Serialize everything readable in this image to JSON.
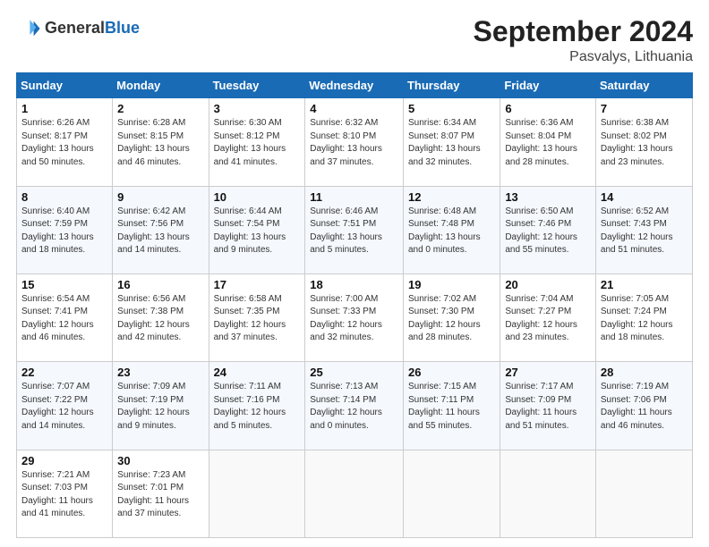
{
  "header": {
    "logo_general": "General",
    "logo_blue": "Blue",
    "month_title": "September 2024",
    "location": "Pasvalys, Lithuania"
  },
  "weekdays": [
    "Sunday",
    "Monday",
    "Tuesday",
    "Wednesday",
    "Thursday",
    "Friday",
    "Saturday"
  ],
  "weeks": [
    [
      {
        "day": "1",
        "info": "Sunrise: 6:26 AM\nSunset: 8:17 PM\nDaylight: 13 hours\nand 50 minutes."
      },
      {
        "day": "2",
        "info": "Sunrise: 6:28 AM\nSunset: 8:15 PM\nDaylight: 13 hours\nand 46 minutes."
      },
      {
        "day": "3",
        "info": "Sunrise: 6:30 AM\nSunset: 8:12 PM\nDaylight: 13 hours\nand 41 minutes."
      },
      {
        "day": "4",
        "info": "Sunrise: 6:32 AM\nSunset: 8:10 PM\nDaylight: 13 hours\nand 37 minutes."
      },
      {
        "day": "5",
        "info": "Sunrise: 6:34 AM\nSunset: 8:07 PM\nDaylight: 13 hours\nand 32 minutes."
      },
      {
        "day": "6",
        "info": "Sunrise: 6:36 AM\nSunset: 8:04 PM\nDaylight: 13 hours\nand 28 minutes."
      },
      {
        "day": "7",
        "info": "Sunrise: 6:38 AM\nSunset: 8:02 PM\nDaylight: 13 hours\nand 23 minutes."
      }
    ],
    [
      {
        "day": "8",
        "info": "Sunrise: 6:40 AM\nSunset: 7:59 PM\nDaylight: 13 hours\nand 18 minutes."
      },
      {
        "day": "9",
        "info": "Sunrise: 6:42 AM\nSunset: 7:56 PM\nDaylight: 13 hours\nand 14 minutes."
      },
      {
        "day": "10",
        "info": "Sunrise: 6:44 AM\nSunset: 7:54 PM\nDaylight: 13 hours\nand 9 minutes."
      },
      {
        "day": "11",
        "info": "Sunrise: 6:46 AM\nSunset: 7:51 PM\nDaylight: 13 hours\nand 5 minutes."
      },
      {
        "day": "12",
        "info": "Sunrise: 6:48 AM\nSunset: 7:48 PM\nDaylight: 13 hours\nand 0 minutes."
      },
      {
        "day": "13",
        "info": "Sunrise: 6:50 AM\nSunset: 7:46 PM\nDaylight: 12 hours\nand 55 minutes."
      },
      {
        "day": "14",
        "info": "Sunrise: 6:52 AM\nSunset: 7:43 PM\nDaylight: 12 hours\nand 51 minutes."
      }
    ],
    [
      {
        "day": "15",
        "info": "Sunrise: 6:54 AM\nSunset: 7:41 PM\nDaylight: 12 hours\nand 46 minutes."
      },
      {
        "day": "16",
        "info": "Sunrise: 6:56 AM\nSunset: 7:38 PM\nDaylight: 12 hours\nand 42 minutes."
      },
      {
        "day": "17",
        "info": "Sunrise: 6:58 AM\nSunset: 7:35 PM\nDaylight: 12 hours\nand 37 minutes."
      },
      {
        "day": "18",
        "info": "Sunrise: 7:00 AM\nSunset: 7:33 PM\nDaylight: 12 hours\nand 32 minutes."
      },
      {
        "day": "19",
        "info": "Sunrise: 7:02 AM\nSunset: 7:30 PM\nDaylight: 12 hours\nand 28 minutes."
      },
      {
        "day": "20",
        "info": "Sunrise: 7:04 AM\nSunset: 7:27 PM\nDaylight: 12 hours\nand 23 minutes."
      },
      {
        "day": "21",
        "info": "Sunrise: 7:05 AM\nSunset: 7:24 PM\nDaylight: 12 hours\nand 18 minutes."
      }
    ],
    [
      {
        "day": "22",
        "info": "Sunrise: 7:07 AM\nSunset: 7:22 PM\nDaylight: 12 hours\nand 14 minutes."
      },
      {
        "day": "23",
        "info": "Sunrise: 7:09 AM\nSunset: 7:19 PM\nDaylight: 12 hours\nand 9 minutes."
      },
      {
        "day": "24",
        "info": "Sunrise: 7:11 AM\nSunset: 7:16 PM\nDaylight: 12 hours\nand 5 minutes."
      },
      {
        "day": "25",
        "info": "Sunrise: 7:13 AM\nSunset: 7:14 PM\nDaylight: 12 hours\nand 0 minutes."
      },
      {
        "day": "26",
        "info": "Sunrise: 7:15 AM\nSunset: 7:11 PM\nDaylight: 11 hours\nand 55 minutes."
      },
      {
        "day": "27",
        "info": "Sunrise: 7:17 AM\nSunset: 7:09 PM\nDaylight: 11 hours\nand 51 minutes."
      },
      {
        "day": "28",
        "info": "Sunrise: 7:19 AM\nSunset: 7:06 PM\nDaylight: 11 hours\nand 46 minutes."
      }
    ],
    [
      {
        "day": "29",
        "info": "Sunrise: 7:21 AM\nSunset: 7:03 PM\nDaylight: 11 hours\nand 41 minutes."
      },
      {
        "day": "30",
        "info": "Sunrise: 7:23 AM\nSunset: 7:01 PM\nDaylight: 11 hours\nand 37 minutes."
      },
      {
        "day": "",
        "info": ""
      },
      {
        "day": "",
        "info": ""
      },
      {
        "day": "",
        "info": ""
      },
      {
        "day": "",
        "info": ""
      },
      {
        "day": "",
        "info": ""
      }
    ]
  ]
}
